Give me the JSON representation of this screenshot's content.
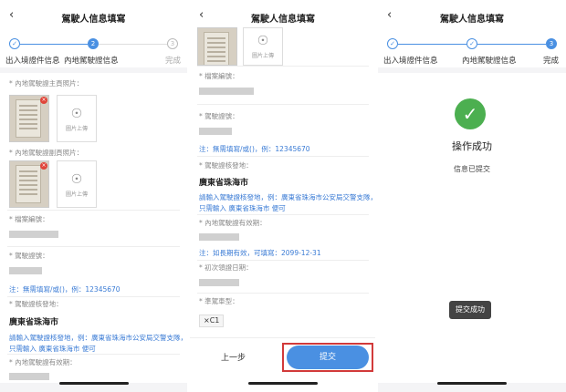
{
  "header": {
    "title": "駕駛人信息填寫",
    "back_icon": "chevron-left-icon"
  },
  "steps": [
    {
      "label": "出入境證件信息",
      "marker": "1"
    },
    {
      "label": "內地駕駛證信息",
      "marker": "2"
    },
    {
      "label": "完成",
      "marker": "3"
    }
  ],
  "colors": {
    "accent": "#4a90e2",
    "success": "#4caf50",
    "highlight": "#d23a3a"
  },
  "screen1": {
    "front_photo_label": "* 內地駕駛證主頁照片：",
    "back_photo_label": "* 內地駕駛證副頁照片：",
    "upload_label": "圖片上傳",
    "file_no_label": "* 檔案編號：",
    "license_no_label": "* 駕駛證號：",
    "note_fill": "注：無需填寫/或()，例：12345670",
    "issuer_label": "* 駕駛證核發地：",
    "issuer_value": "廣東省珠海市",
    "issuer_note_1": "請輸入駕駛證核發地，例：廣東省珠海市公安局交警支隊，",
    "issuer_note_2": "只需輸入 廣東省珠海市 便可",
    "validity_label": "* 內地駕駛證有效期："
  },
  "screen2": {
    "upload_label": "圖片上傳",
    "file_no_label": "* 檔案編號：",
    "license_no_label": "* 駕駛證號：",
    "note_fill": "注：無需填寫/或()，例：12345670",
    "issuer_label": "* 駕駛證核發地：",
    "issuer_value": "廣東省珠海市",
    "issuer_note_1": "請輸入駕駛證核發地，例：廣東省珠海市公安局交警支隊，",
    "issuer_note_2": "只需輸入 廣東省珠海市 便可",
    "validity_label": "* 內地駕駛證有效期：",
    "validity_note": "注：如長期有效，可填寫：2099-12-31",
    "first_issue_label": "* 初次領證日期：",
    "vehicle_type_label": "* 準駕車型：",
    "vehicle_type_value": "C1",
    "prev_label": "上一步",
    "submit_label": "提交"
  },
  "screen3": {
    "success_title": "操作成功",
    "success_sub": "信息已提交",
    "toast": "提交成功"
  }
}
